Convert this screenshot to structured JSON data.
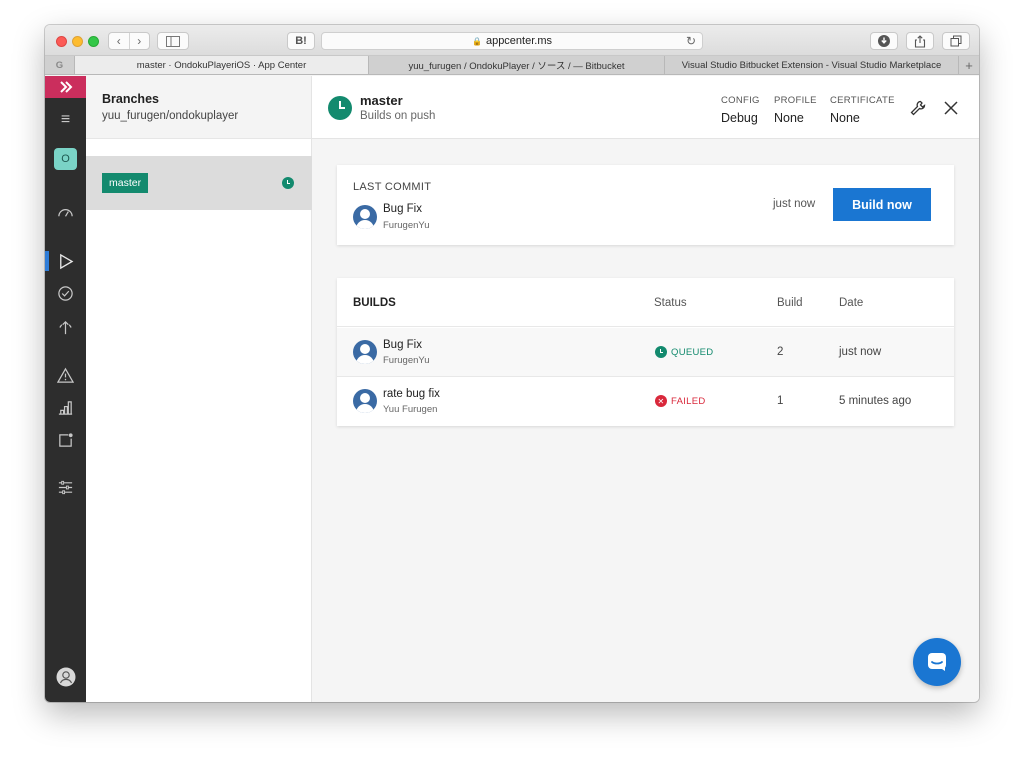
{
  "browser": {
    "url": "appcenter.ms",
    "hatena_label": "B!",
    "tab_g": "G",
    "tabs": [
      {
        "label": "master · OndokuPlayeriOS · App Center",
        "active": true
      },
      {
        "label": "yuu_furugen / OndokuPlayer / ソース / — Bitbucket",
        "active": false
      },
      {
        "label": "Visual Studio Bitbucket Extension - Visual Studio Marketplace",
        "active": false
      }
    ],
    "new_tab": "+"
  },
  "rail": {
    "app_initial": "O",
    "accent": "#cb2e5d"
  },
  "branches_panel": {
    "title": "Branches",
    "repo": "yuu_furugen/ondokuplayer",
    "branches": [
      {
        "name": "master",
        "status": "queued"
      }
    ]
  },
  "main": {
    "branch_name": "master",
    "branch_sub": "Builds on push",
    "config": {
      "label": "CONFIG",
      "value": "Debug"
    },
    "profile": {
      "label": "PROFILE",
      "value": "None"
    },
    "certificate": {
      "label": "CERTIFICATE",
      "value": "None"
    }
  },
  "last_commit": {
    "label": "LAST COMMIT",
    "title": "Bug Fix",
    "author": "FurugenYu",
    "when": "just now",
    "build_button": "Build now"
  },
  "builds": {
    "title": "BUILDS",
    "columns": {
      "status": "Status",
      "build": "Build",
      "date": "Date"
    },
    "rows": [
      {
        "title": "Bug Fix",
        "author": "FurugenYu",
        "status": "QUEUED",
        "build": "2",
        "date": "just now"
      },
      {
        "title": "rate bug fix",
        "author": "Yuu Furugen",
        "status": "FAILED",
        "build": "1",
        "date": "5 minutes ago"
      }
    ]
  },
  "colors": {
    "queued": "#138a6e",
    "failed": "#d9283b",
    "primary": "#1a76d2"
  }
}
